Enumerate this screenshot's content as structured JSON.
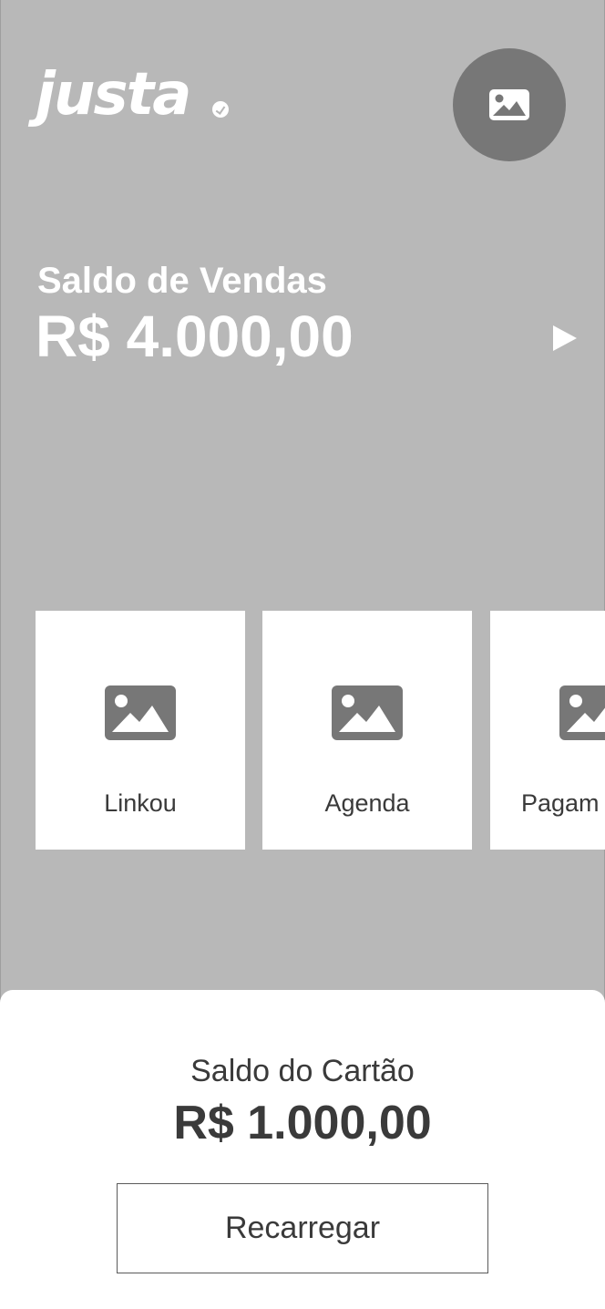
{
  "header": {
    "logo_text": "justa",
    "avatar_icon": "image-icon"
  },
  "sales_balance": {
    "label": "Saldo de Vendas",
    "value": "R$ 4.000,00",
    "details_icon": "play-arrow-icon"
  },
  "shortcuts": [
    {
      "label": "Linkou",
      "icon": "image-icon"
    },
    {
      "label": "Agenda",
      "icon": "image-icon"
    },
    {
      "label": "Pagam",
      "icon": "image-icon"
    }
  ],
  "card_balance": {
    "label": "Saldo do Cartão",
    "value": "R$ 1.000,00",
    "button_label": "Recarregar"
  },
  "colors": {
    "panel_bg": "#b8b8b8",
    "avatar_bg": "#777777",
    "icon_gray": "#777777",
    "text_dark": "#3a3a3a"
  }
}
